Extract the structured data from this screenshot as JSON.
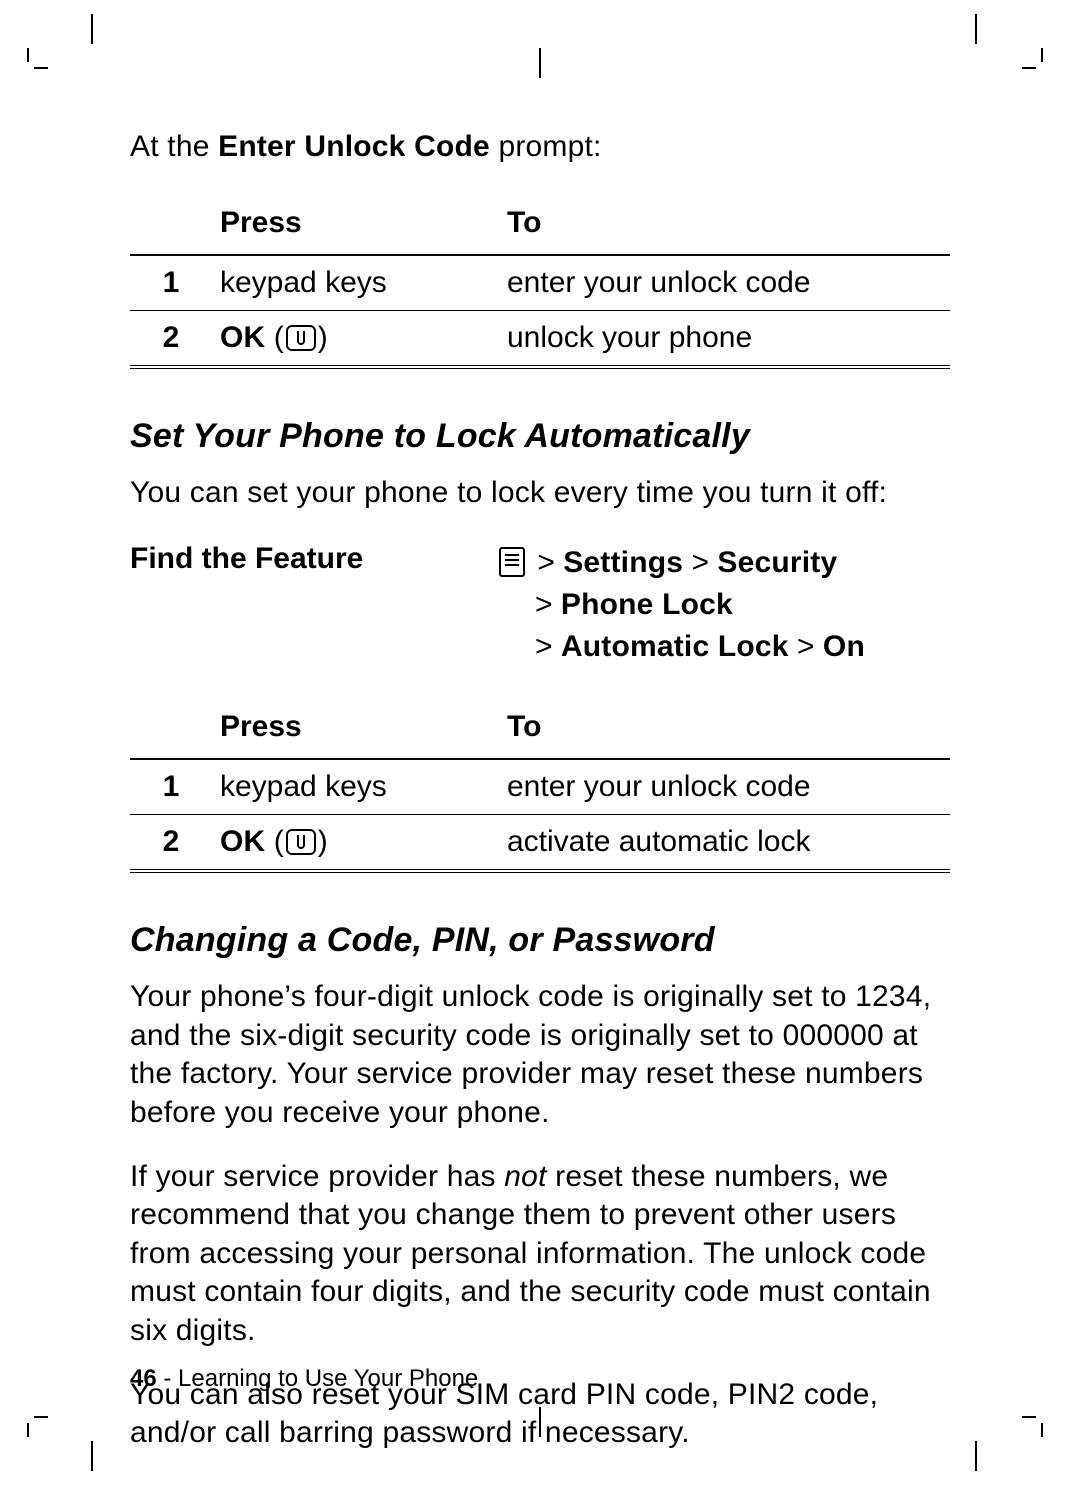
{
  "intro": {
    "prefix": "At the ",
    "prompt_label": "Enter Unlock Code",
    "suffix": " prompt:"
  },
  "table1": {
    "head_press": "Press",
    "head_to": "To",
    "rows": [
      {
        "n": "1",
        "press": "keypad keys",
        "to": "enter your unlock code",
        "press_style": "plain"
      },
      {
        "n": "2",
        "press_label": "OK",
        "to": "unlock your phone",
        "press_style": "ok"
      }
    ]
  },
  "heading1": "Set Your Phone to Lock Automatically",
  "para1": "You can set your phone to lock every time you turn it off:",
  "feature": {
    "label": "Find the Feature",
    "line1_prefix": " > ",
    "line1_a": "Settings",
    "line1_sep": " > ",
    "line1_b": "Security",
    "line2_prefix": "> ",
    "line2": "Phone Lock",
    "line3_prefix": "> ",
    "line3_a": "Automatic Lock",
    "line3_sep": " > ",
    "line3_b": "On"
  },
  "table2": {
    "head_press": "Press",
    "head_to": "To",
    "rows": [
      {
        "n": "1",
        "press": "keypad keys",
        "to": "enter your unlock code",
        "press_style": "plain"
      },
      {
        "n": "2",
        "press_label": "OK",
        "to": "activate automatic lock",
        "press_style": "ok"
      }
    ]
  },
  "heading2": "Changing a Code, PIN, or Password",
  "para2": "Your phone’s four-digit unlock code is originally set to 1234, and the six-digit security code is originally set to 000000 at the factory. Your service provider may reset these numbers before you receive your phone.",
  "para3_a": "If your service provider has ",
  "para3_i": "not",
  "para3_b": " reset these numbers, we recommend that you change them to prevent other users from accessing your personal information. The unlock code must contain four digits, and the security code must contain six digits.",
  "para4": "You can also reset your SIM card PIN code, PIN2 code, and/or call barring password if necessary.",
  "footer": {
    "page": "46",
    "sep": " - ",
    "section": "Learning to Use Your Phone"
  }
}
